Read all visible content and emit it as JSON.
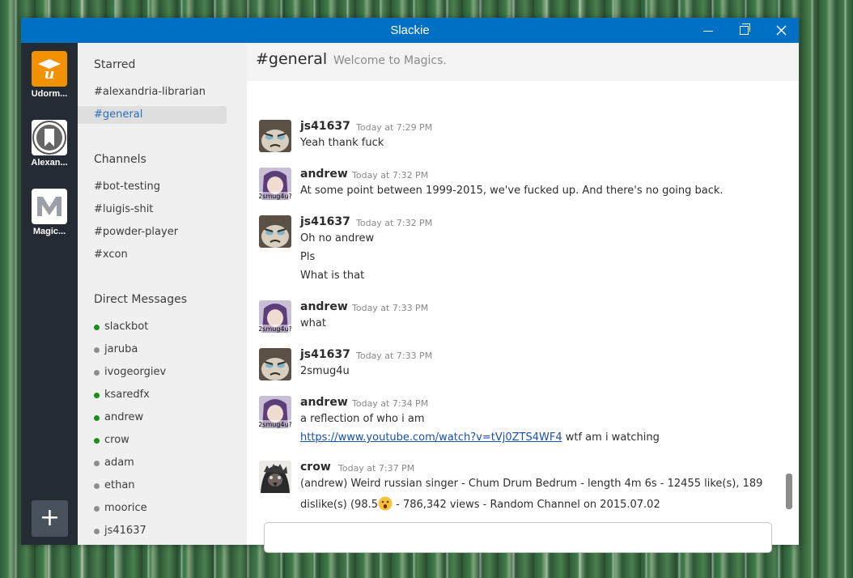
{
  "window": {
    "title": "Slackie"
  },
  "teams": [
    {
      "name": "Udorm..."
    },
    {
      "name": "Alexan..."
    },
    {
      "name": "Magic..."
    }
  ],
  "sidebar": {
    "starred_heading": "Starred",
    "starred": [
      "#alexandria-librarian",
      "#general"
    ],
    "channels_heading": "Channels",
    "channels": [
      "#bot-testing",
      "#luigis-shit",
      "#powder-player",
      "#xcon"
    ],
    "dm_heading": "Direct Messages",
    "dms": [
      {
        "name": "slackbot",
        "status": "online"
      },
      {
        "name": "jaruba",
        "status": "away"
      },
      {
        "name": "ivogeorgiev",
        "status": "away"
      },
      {
        "name": "ksaredfx",
        "status": "online"
      },
      {
        "name": "andrew",
        "status": "online"
      },
      {
        "name": "crow",
        "status": "online"
      },
      {
        "name": "adam",
        "status": "away"
      },
      {
        "name": "ethan",
        "status": "away"
      },
      {
        "name": "moorice",
        "status": "away"
      },
      {
        "name": "js41637",
        "status": "away"
      }
    ]
  },
  "channel": {
    "name": "#general",
    "topic": "Welcome to Magics."
  },
  "messages": [
    {
      "author": "js41637",
      "time": "Today at 7:29 PM",
      "lines": [
        "Yeah thank fuck"
      ]
    },
    {
      "author": "andrew",
      "time": "Today at 7:32 PM",
      "lines": [
        "At some point between 1999-2015, we've fucked up. And there's no going back."
      ]
    },
    {
      "author": "js41637",
      "time": "Today at 7:32 PM",
      "lines": [
        "Oh no andrew",
        "Pls",
        "What is that"
      ]
    },
    {
      "author": "andrew",
      "time": "Today at 7:33 PM",
      "lines": [
        "what"
      ]
    },
    {
      "author": "js41637",
      "time": "Today at 7:33 PM",
      "lines": [
        "2smug4u"
      ]
    },
    {
      "author": "andrew",
      "time": "Today at 7:34 PM",
      "lines": [
        "a reflection of who i am"
      ],
      "link": "https://www.youtube.com/watch?v=tVj0ZTS4WF4",
      "after_link": " wtf am i watching"
    },
    {
      "author": "crow",
      "time": "Today at 7:37 PM",
      "lines": [
        "(andrew) Weird russian singer - Chum Drum Bedrum - length 4m 6s - 12455 like(s), 189",
        "dislike(s) (98.5",
        " - 786,342 views - Random Channel on 2015.07.02"
      ]
    }
  ],
  "avatar_labels": {
    "andrew": "2smug4u?"
  },
  "colors": {
    "titlebar": "#0070c4",
    "rail": "#252b33",
    "online": "#1a8f1a",
    "away": "#8e8e8e",
    "link": "#1a4fb0",
    "udorm_orange": "#f39200"
  },
  "icons": {
    "add_team": "plus-icon",
    "minimize": "minimize-icon",
    "maximize": "restore-icon",
    "close": "close-icon"
  },
  "add_team_label": "+"
}
